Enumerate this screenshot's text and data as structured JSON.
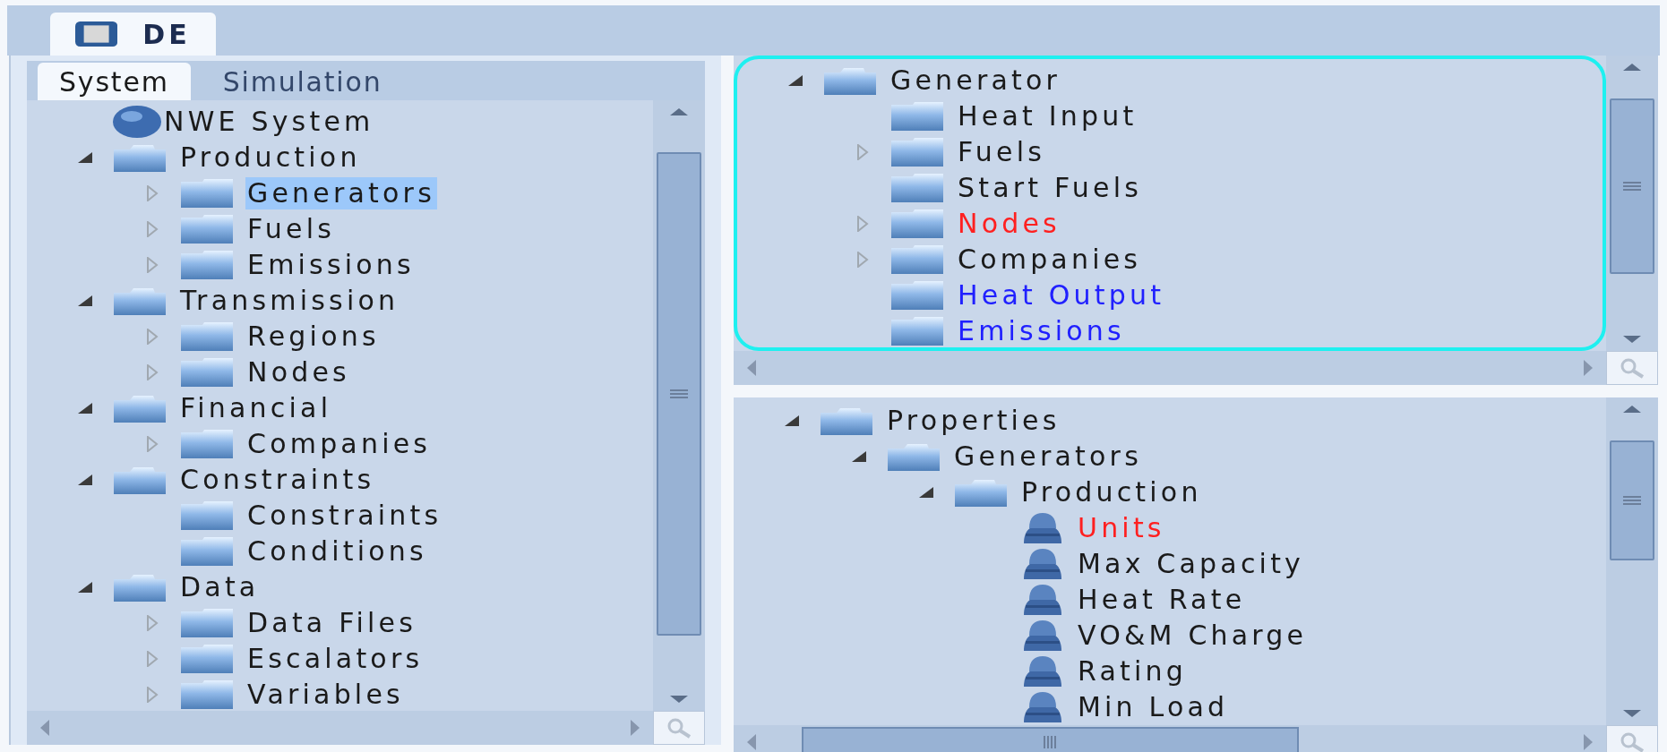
{
  "document_tab": {
    "label": "DE"
  },
  "left_panel": {
    "tabs": [
      {
        "label": "System",
        "selected": true
      },
      {
        "label": "Simulation",
        "selected": false
      }
    ],
    "tree": [
      {
        "label": "NWE System",
        "kind": "globe",
        "selected": false
      },
      {
        "label": "Production",
        "kind": "open_folder",
        "expanded": true,
        "selected": false,
        "children": [
          {
            "label": "Generators",
            "kind": "folder",
            "expanded": false,
            "selected": true
          },
          {
            "label": "Fuels",
            "kind": "folder",
            "expanded": false,
            "selected": false
          },
          {
            "label": "Emissions",
            "kind": "folder",
            "expanded": false,
            "selected": false
          }
        ]
      },
      {
        "label": "Transmission",
        "kind": "open_folder",
        "expanded": true,
        "selected": false,
        "children": [
          {
            "label": "Regions",
            "kind": "folder",
            "expanded": false,
            "selected": false
          },
          {
            "label": "Nodes",
            "kind": "folder",
            "expanded": false,
            "selected": false
          }
        ]
      },
      {
        "label": "Financial",
        "kind": "open_folder",
        "expanded": true,
        "selected": false,
        "children": [
          {
            "label": "Companies",
            "kind": "folder",
            "expanded": false,
            "selected": false
          }
        ]
      },
      {
        "label": "Constraints",
        "kind": "open_folder",
        "expanded": true,
        "selected": false,
        "children": [
          {
            "label": "Constraints",
            "kind": "folder",
            "selected": false
          },
          {
            "label": "Conditions",
            "kind": "folder",
            "selected": false
          }
        ]
      },
      {
        "label": "Data",
        "kind": "open_folder",
        "expanded": true,
        "selected": false,
        "children": [
          {
            "label": "Data Files",
            "kind": "folder",
            "expanded": false,
            "selected": false
          },
          {
            "label": "Escalators",
            "kind": "folder",
            "expanded": false,
            "selected": false
          },
          {
            "label": "Variables",
            "kind": "folder",
            "expanded": false,
            "selected": false
          }
        ]
      }
    ]
  },
  "memberships_panel": {
    "highlighted": true,
    "tree": [
      {
        "label": "Generator",
        "kind": "open_folder",
        "expanded": true,
        "children": [
          {
            "label": "Heat Input",
            "kind": "folder"
          },
          {
            "label": "Fuels",
            "kind": "folder",
            "expanded": false
          },
          {
            "label": "Start Fuels",
            "kind": "folder"
          },
          {
            "label": "Nodes",
            "kind": "folder",
            "expanded": false,
            "color": "#ff2020"
          },
          {
            "label": "Companies",
            "kind": "folder",
            "expanded": false
          },
          {
            "label": "Heat Output",
            "kind": "folder",
            "color": "#2020ff"
          },
          {
            "label": "Emissions",
            "kind": "folder",
            "color": "#2020ff"
          }
        ]
      }
    ]
  },
  "properties_panel": {
    "tree": [
      {
        "label": "Properties",
        "kind": "open_folder",
        "expanded": true,
        "children": [
          {
            "label": "Generators",
            "kind": "open_folder",
            "expanded": true,
            "children": [
              {
                "label": "Production",
                "kind": "open_folder",
                "expanded": true,
                "children": [
                  {
                    "label": "Units",
                    "kind": "property",
                    "color": "#ff2020"
                  },
                  {
                    "label": "Max Capacity",
                    "kind": "property"
                  },
                  {
                    "label": "Heat Rate",
                    "kind": "property"
                  },
                  {
                    "label": "VO&M Charge",
                    "kind": "property"
                  },
                  {
                    "label": "Rating",
                    "kind": "property"
                  },
                  {
                    "label": "Min Load",
                    "kind": "property"
                  }
                ]
              }
            ]
          }
        ]
      }
    ]
  }
}
